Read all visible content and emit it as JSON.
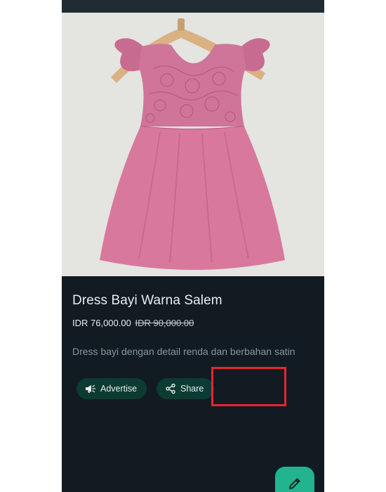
{
  "product": {
    "title": "Dress Bayi Warna Salem",
    "price": "IDR 76,000.00",
    "original_price": "IDR 90,000.00",
    "description": "Dress bayi dengan detail renda dan berbahan satin",
    "image_icon": "pink-lace-baby-dress-on-hanger"
  },
  "actions": {
    "advertise_label": "Advertise",
    "advertise_icon": "megaphone-icon",
    "share_label": "Share",
    "share_icon": "share-icon",
    "edit_icon": "pencil-icon"
  },
  "colors": {
    "background": "#121b22",
    "chip": "#0b3b33",
    "fab": "#22b38f",
    "highlight": "#e8242f",
    "dress": "#d8789d"
  }
}
